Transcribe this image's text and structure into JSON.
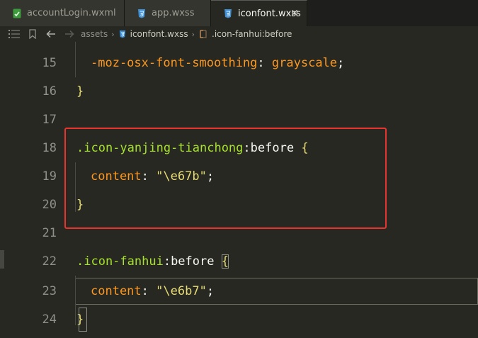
{
  "tabs": [
    {
      "label": "accountLogin.wxml",
      "icon": "wxml-file-icon",
      "active": false
    },
    {
      "label": "app.wxss",
      "icon": "css-file-icon",
      "active": false
    },
    {
      "label": "iconfont.wxss",
      "icon": "css-file-icon",
      "active": true
    }
  ],
  "breadcrumb": {
    "items": [
      "assets",
      "iconfont.wxss",
      ".icon-fanhui:before"
    ]
  },
  "editor": {
    "lines": [
      {
        "number": "15",
        "text": "-moz-osx-font-smoothing: grayscale;"
      },
      {
        "number": "16",
        "text": "}"
      },
      {
        "number": "17",
        "text": ""
      },
      {
        "number": "18",
        "selector": ".icon-yanjing-tianchong",
        "pseudo": ":before",
        "brace": "{"
      },
      {
        "number": "19",
        "prop": "content",
        "value": "\"\\e67b\"",
        "semicolon": ";"
      },
      {
        "number": "20",
        "text": "}"
      },
      {
        "number": "21",
        "text": ""
      },
      {
        "number": "22",
        "selector": ".icon-fanhui",
        "pseudo": ":before",
        "brace": "{"
      },
      {
        "number": "23",
        "prop": "content",
        "value": "\"\\e6b7\"",
        "semicolon": ";"
      },
      {
        "number": "24",
        "text": "}"
      }
    ],
    "line15": {
      "prop": "-moz-osx-font-smoothing",
      "colon": ":",
      "value": "grayscale",
      "semicolon": ";"
    },
    "highlight_color": "#e8332e"
  }
}
